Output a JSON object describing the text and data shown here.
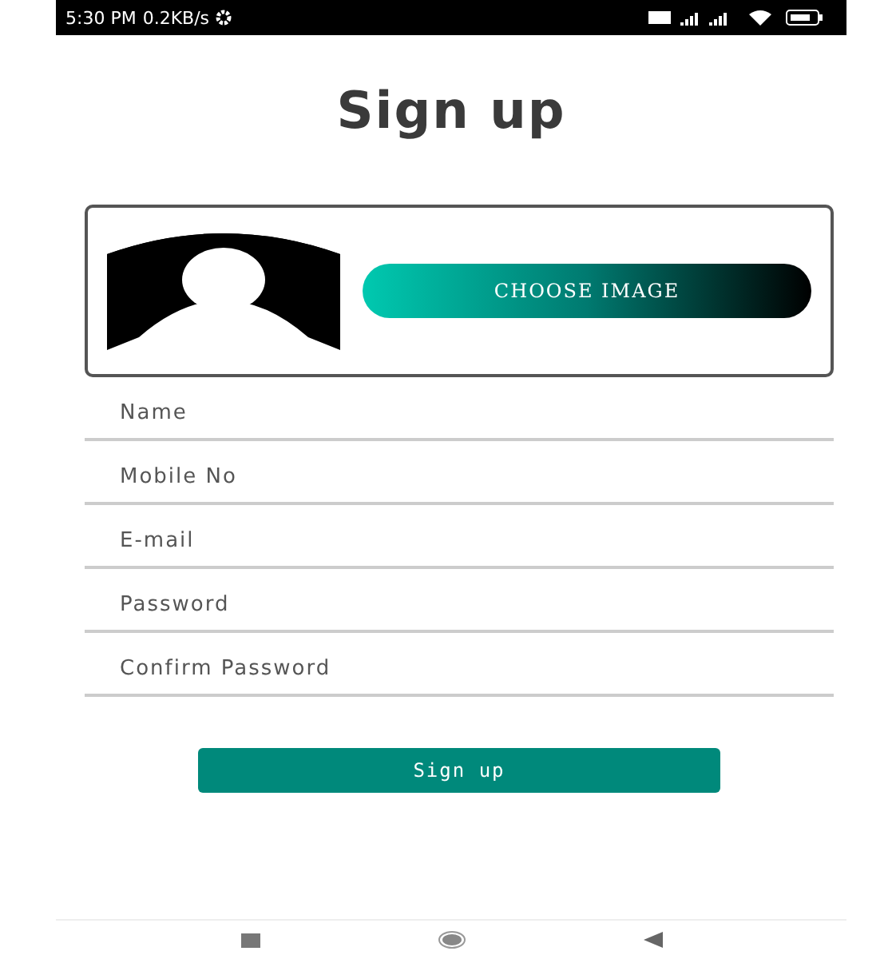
{
  "status_bar": {
    "time": "5:30 PM",
    "speed": "0.2KB/s"
  },
  "title": "Sign up",
  "avatar": {
    "button": "CHOOSE IMAGE"
  },
  "fields": [
    {
      "placeholder": "Name"
    },
    {
      "placeholder": "Mobile No"
    },
    {
      "placeholder": "E-mail"
    },
    {
      "placeholder": "Password"
    },
    {
      "placeholder": "Confirm Password"
    }
  ],
  "submit": "Sign up"
}
